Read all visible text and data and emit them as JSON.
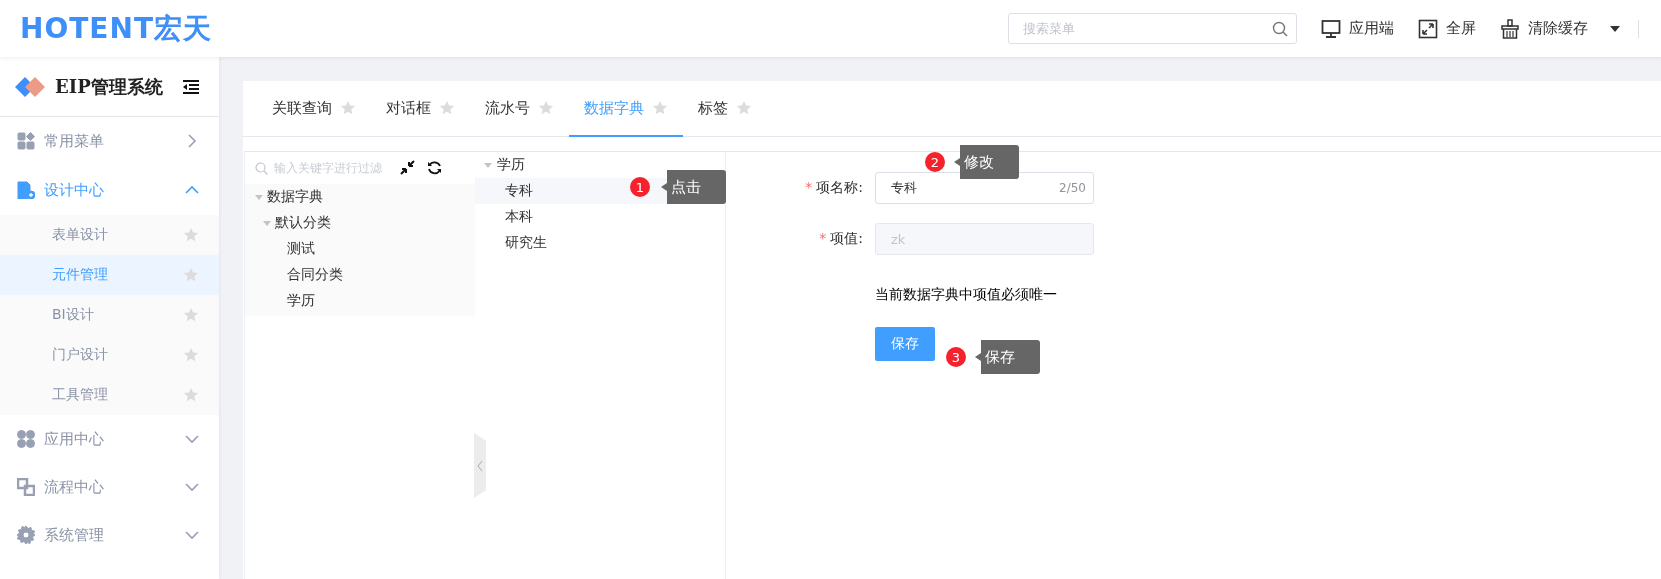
{
  "header": {
    "logo": "HOTENT宏天",
    "search": {
      "placeholder": "搜索菜单"
    },
    "actions": [
      {
        "kind": "monitor",
        "label": "应用端",
        "dropdown": false
      },
      {
        "kind": "fullscreen",
        "label": "全屏",
        "dropdown": false
      },
      {
        "kind": "clear-cache",
        "label": "清除缓存",
        "dropdown": true
      }
    ]
  },
  "sidebar": {
    "title": "EIP管理系统",
    "items": [
      {
        "kind": "grid",
        "label": "常用菜单",
        "popout": true,
        "expanded": false
      },
      {
        "kind": "design",
        "label": "设计中心",
        "popout": false,
        "expanded": true,
        "children": [
          {
            "label": "表单设计",
            "selected": false
          },
          {
            "label": "元件管理",
            "selected": true
          },
          {
            "label": "BI设计",
            "selected": false
          },
          {
            "label": "门户设计",
            "selected": false
          },
          {
            "label": "工具管理",
            "selected": false
          }
        ]
      },
      {
        "kind": "apps",
        "label": "应用中心",
        "popout": false,
        "expanded": false
      },
      {
        "kind": "flow",
        "label": "流程中心",
        "popout": false,
        "expanded": false
      },
      {
        "kind": "gear",
        "label": "系统管理",
        "popout": false,
        "expanded": false
      }
    ]
  },
  "tabs": [
    {
      "label": "关联查询",
      "selected": false
    },
    {
      "label": "对话框",
      "selected": false
    },
    {
      "label": "流水号",
      "selected": false
    },
    {
      "label": "数据字典",
      "selected": true
    },
    {
      "label": "标签",
      "selected": false
    }
  ],
  "tree": {
    "placeholder": "输入关键字进行过滤",
    "nodes": [
      {
        "label": "数据字典",
        "expanded": true,
        "children": [
          {
            "label": "默认分类",
            "expanded": true,
            "children": [
              {
                "label": "测试"
              },
              {
                "label": "合同分类"
              },
              {
                "label": "学历"
              }
            ]
          }
        ]
      }
    ]
  },
  "list": {
    "label": "学历",
    "expanded": true,
    "children": [
      {
        "label": "专科",
        "selected": true
      },
      {
        "label": "本科",
        "selected": false
      },
      {
        "label": "研究生",
        "selected": false
      }
    ]
  },
  "form": {
    "fields": [
      {
        "required_mark": "*",
        "label": "项名称:",
        "value": "专科",
        "counter": "2/50",
        "disabled": false
      },
      {
        "required_mark": "*",
        "label": "项值:",
        "value": "zk",
        "disabled": true
      }
    ],
    "note": "当前数据字典中项值必须唯一",
    "submit": "保存"
  },
  "annotations": [
    {
      "number": "1",
      "text": "点击"
    },
    {
      "number": "2",
      "text": "修改"
    },
    {
      "number": "3",
      "text": "保存"
    }
  ]
}
